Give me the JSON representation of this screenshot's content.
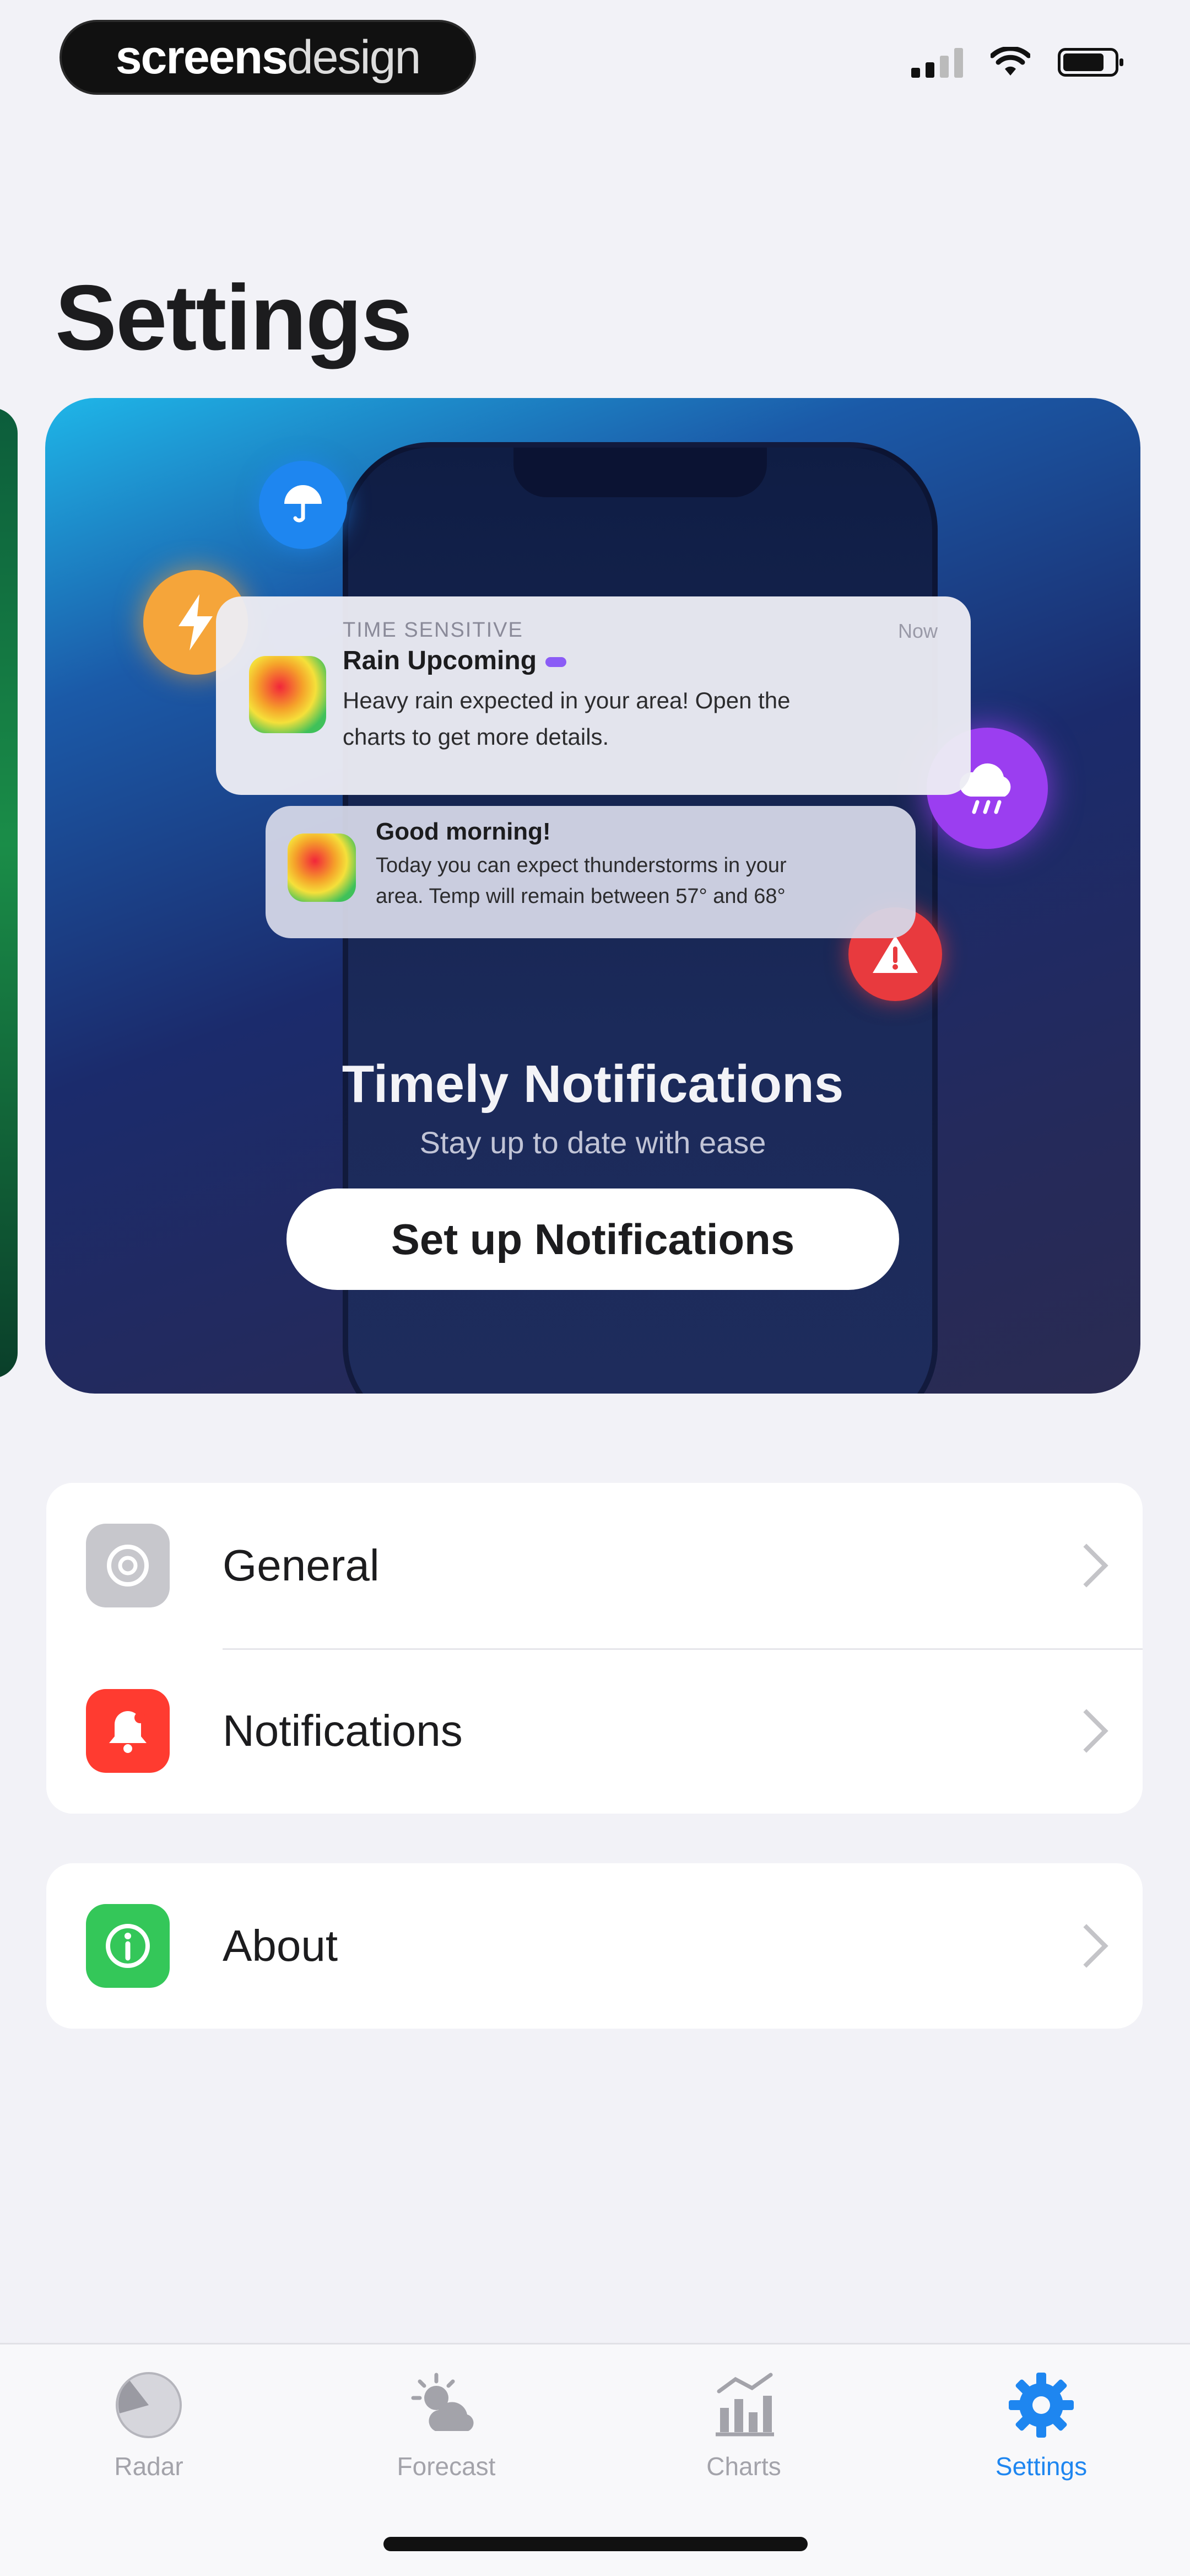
{
  "status_bar": {
    "brand_bold": "screens",
    "brand_light": "design"
  },
  "page": {
    "title": "Settings"
  },
  "promo": {
    "notification_primary": {
      "eyebrow": "TIME SENSITIVE",
      "time": "Now",
      "title": "Rain Upcoming",
      "body_line1": "Heavy rain expected in your area! Open the",
      "body_line2": "charts to get more details."
    },
    "notification_secondary": {
      "title": "Good morning!",
      "body_line1": "Today you can expect thunderstorms in your",
      "body_line2": "area. Temp will remain between 57° and 68°"
    },
    "title": "Timely Notifications",
    "subtitle": "Stay up to date with ease",
    "button_label": "Set up Notifications"
  },
  "settings_groups": [
    {
      "items": [
        {
          "label": "General",
          "icon": "gear-icon",
          "color": "#c7c7cc"
        },
        {
          "label": "Notifications",
          "icon": "bell-icon",
          "color": "#ff3b30"
        }
      ]
    },
    {
      "items": [
        {
          "label": "About",
          "icon": "info-icon",
          "color": "#34c759"
        }
      ]
    }
  ],
  "tab_bar": {
    "tabs": [
      {
        "label": "Radar",
        "icon": "radar-icon"
      },
      {
        "label": "Forecast",
        "icon": "forecast-icon"
      },
      {
        "label": "Charts",
        "icon": "charts-icon"
      },
      {
        "label": "Settings",
        "icon": "gear-icon",
        "active": true
      }
    ],
    "active_color": "#1e86f0"
  }
}
